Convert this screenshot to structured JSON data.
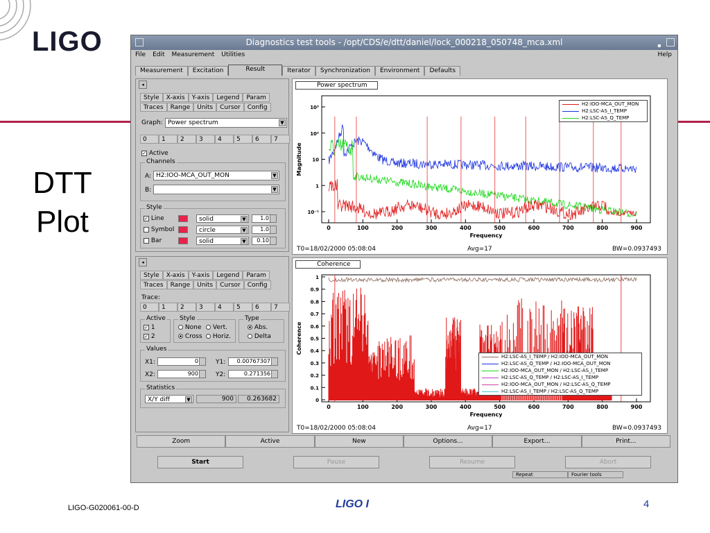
{
  "slide": {
    "logo": "LIGO",
    "title_line1": "DTT",
    "title_line2": "Plot",
    "footer_left": "LIGO-G020061-00-D",
    "footer_mid": "LIGO I",
    "footer_right": "4"
  },
  "window": {
    "title": "Diagnostics test tools - /opt/CDS/e/dtt/daniel/lock_000218_050748_mca.xml",
    "menu": {
      "file": "File",
      "edit": "Edit",
      "measurement": "Measurement",
      "utilities": "Utilities",
      "help": "Help"
    },
    "tabs": [
      "Measurement",
      "Excitation",
      "Result",
      "Iterator",
      "Synchronization",
      "Environment",
      "Defaults"
    ],
    "active_tab": "Result"
  },
  "top_panel": {
    "tabs_row1": [
      "Style",
      "X-axis",
      "Y-axis",
      "Legend",
      "Param"
    ],
    "tabs_row2": [
      "Traces",
      "Range",
      "Units",
      "Cursor",
      "Config"
    ],
    "graph_label": "Graph:",
    "graph_value": "Power spectrum",
    "trace_tabs": [
      "0",
      "1",
      "2",
      "3",
      "4",
      "5",
      "6",
      "7"
    ],
    "active_label": "Active",
    "channels_label": "Channels",
    "a_label": "A:",
    "a_value": "H2:IOO-MCA_OUT_MON",
    "b_label": "B:",
    "style_label": "Style",
    "line_label": "Line",
    "line_style": "solid",
    "line_width": "1.0",
    "symbol_label": "Symbol",
    "symbol_style": "circle",
    "symbol_size": "1.0",
    "bar_label": "Bar",
    "bar_style": "solid",
    "bar_width": "0.10"
  },
  "bottom_panel": {
    "tabs_row1": [
      "Style",
      "X-axis",
      "Y-axis",
      "Legend",
      "Param"
    ],
    "tabs_row2": [
      "Traces",
      "Range",
      "Units",
      "Cursor",
      "Config"
    ],
    "trace_label": "Trace:",
    "trace_tabs": [
      "0",
      "1",
      "2",
      "3",
      "4",
      "5",
      "6",
      "7"
    ],
    "active_group": "Active",
    "active1": "1",
    "active2": "2",
    "style_group": "Style",
    "none": "None",
    "vert": "Vert.",
    "cross": "Cross",
    "horiz": "Horiz.",
    "type_group": "Type",
    "abs": "Abs.",
    "delta": "Delta",
    "values_group": "Values",
    "x1_label": "X1:",
    "x1": "0",
    "y1_label": "Y1:",
    "y1": "0.00767307",
    "x2_label": "X2:",
    "x2": "900",
    "y2_label": "Y2:",
    "y2": "0.271356",
    "stats_group": "Statistics",
    "stat_sel": "X/Y diff",
    "stat_a": "900",
    "stat_b": "0.263682"
  },
  "plot1": {
    "title": "Power spectrum",
    "ylabel": "Magnitude",
    "xlabel": "Frequency",
    "foot_t0": "T0=18/02/2000 05:08:04",
    "foot_avg": "Avg=17",
    "foot_bw": "BW=0.0937493",
    "xticks": [
      "0",
      "100",
      "200",
      "300",
      "400",
      "500",
      "600",
      "700",
      "800",
      "900"
    ],
    "yticks": [
      "10³",
      "10²",
      "10",
      "1",
      "10⁻¹"
    ],
    "legend": [
      {
        "name": "H2:IOO-MCA_OUT_MON",
        "color": "#e01818"
      },
      {
        "name": "H2:LSC-AS_I_TEMP",
        "color": "#1830e0"
      },
      {
        "name": "H2:LSC-AS_Q_TEMP",
        "color": "#18d818"
      }
    ]
  },
  "plot2": {
    "title": "Coherence",
    "ylabel": "Coherence",
    "xlabel": "Frequency",
    "foot_t0": "T0=18/02/2000 05:08:04",
    "foot_avg": "Avg=17",
    "foot_bw": "BW=0.0937493",
    "xticks": [
      "0",
      "100",
      "200",
      "300",
      "400",
      "500",
      "600",
      "700",
      "800",
      "900"
    ],
    "yticks": [
      "1",
      "0.9",
      "0.8",
      "0.7",
      "0.6",
      "0.5",
      "0.4",
      "0.3",
      "0.2",
      "0.1",
      "0"
    ],
    "legend": [
      {
        "name": "H2:LSC-AS_I_TEMP / H2:IOO-MCA_OUT_MON",
        "color": "#8a6a5a"
      },
      {
        "name": "H2:LSC-AS_Q_TEMP / H2:IOO-MCA_OUT_MON",
        "color": "#1830e0"
      },
      {
        "name": "H2:IOO-MCA_OUT_MON / H2:LSC-AS_I_TEMP",
        "color": "#18d818"
      },
      {
        "name": "H2:LSC-AS_Q_TEMP / H2:LSC-AS_I_TEMP",
        "color": "#c040c0"
      },
      {
        "name": "H2:IOO-MCA_OUT_MON / H2:LSC-AS_Q_TEMP",
        "color": "#d040a0"
      },
      {
        "name": "H2:LSC-AS_I_TEMP / H2:LSC-AS_Q_TEMP",
        "color": "#40c8d0"
      }
    ]
  },
  "bottom_bar": [
    "Zoom",
    "Active",
    "New",
    "Options...",
    "Export...",
    "Print..."
  ],
  "start_buttons": {
    "start": "Start",
    "pause": "Pause",
    "resume": "Resume",
    "abort": "Abort"
  },
  "status": {
    "repeat": "Repeat",
    "fourier": "Fourier tools"
  }
}
